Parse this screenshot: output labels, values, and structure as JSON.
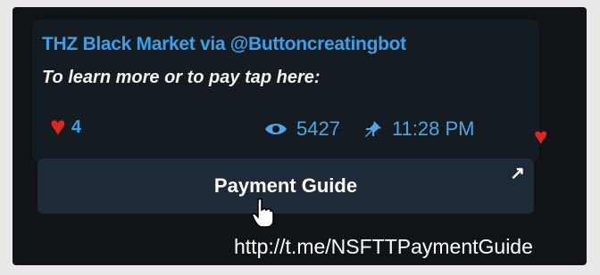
{
  "message": {
    "sender": "THZ Black Market via @Buttoncreatingbot",
    "text": "To learn more or to pay tap here:",
    "reaction": {
      "icon": "heart-icon",
      "count": "4"
    },
    "views": "5427",
    "time": "11:28 PM"
  },
  "inline_button": {
    "label": "Payment Guide",
    "icon": "external-link-arrow-icon"
  },
  "link_tooltip": "http://t.me/NSFTTPaymentGuide",
  "colors": {
    "accent": "#3aa0ea",
    "heart": "#e0261f",
    "button_bg": "#1f2a38",
    "chat_bg": "#101417"
  }
}
